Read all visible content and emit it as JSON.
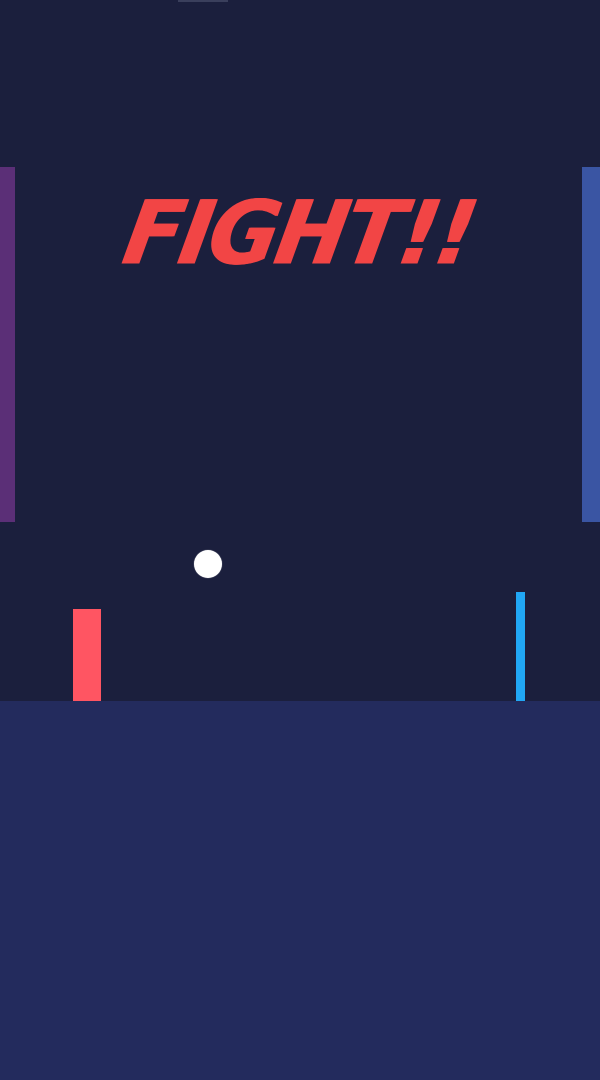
{
  "game": {
    "banner_text": "FIGHT!!"
  },
  "colors": {
    "background": "#1b1f3d",
    "floor": "#232b5d",
    "left_wall": "#5b2f77",
    "right_wall": "#3a55a3",
    "banner": "#f24545",
    "ball": "#ffffff",
    "left_paddle": "#ff5562",
    "right_paddle": "#21a7f5"
  }
}
